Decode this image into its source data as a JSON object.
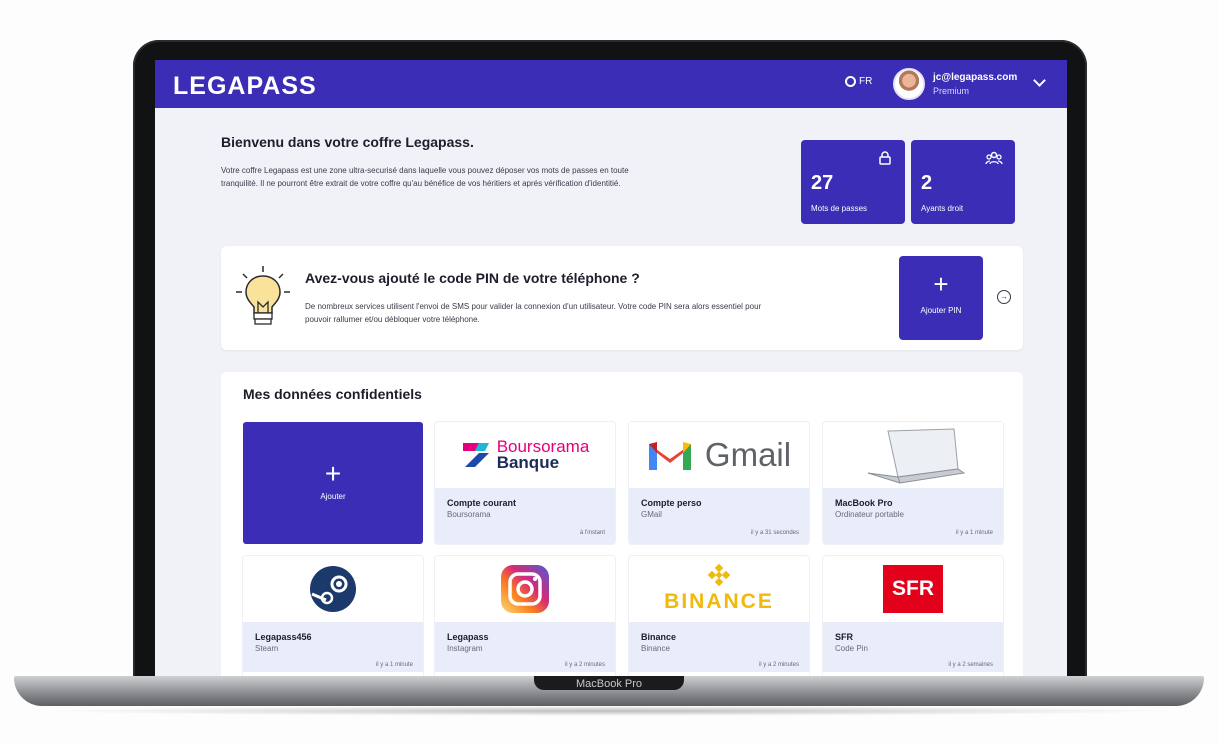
{
  "device": {
    "model_label": "MacBook Pro"
  },
  "header": {
    "logo": "LEGAPASS",
    "lang": "FR",
    "user_email": "jc@legapass.com",
    "user_plan": "Premium",
    "accent": "#3b2db5"
  },
  "welcome": {
    "title": "Bienvenu dans votre coffre Legapass.",
    "text": "Votre coffre Legapass est une zone ultra-securisé dans laquelle vous pouvez déposer vos mots de passes en toute tranquilité. Il ne pourront être extrait de votre coffre qu'au bénéfice de vos héritiers et aprés vérification d'identitié."
  },
  "stats": [
    {
      "value": "27",
      "label": "Mots de passes",
      "icon": "lock-icon"
    },
    {
      "value": "2",
      "label": "Ayants droit",
      "icon": "users-icon"
    }
  ],
  "pin_card": {
    "title": "Avez-vous ajouté le code PIN de votre téléphone ?",
    "text": "De nombreux services utilisent l'envoi de SMS pour valider la connexion d'un utilisateur. Votre code PIN sera alors essentiel pour pouvoir rallumer et/ou débloquer votre téléphone.",
    "button_label": "Ajouter PIN"
  },
  "data_section": {
    "title": "Mes données confidentiels",
    "add_label": "Ajouter",
    "items": [
      {
        "title": "Compte courant",
        "subtitle": "Boursorama",
        "time": "à l'instant",
        "logo_line1": "Boursorama",
        "logo_line2": "Banque"
      },
      {
        "title": "Compte perso",
        "subtitle": "GMail",
        "time": "il y a 31 secondes",
        "logo_text": "Gmail"
      },
      {
        "title": "MacBook Pro",
        "subtitle": "Ordinateur portable",
        "time": "il y a 1 minute"
      },
      {
        "title": "Legapass456",
        "subtitle": "Steam",
        "time": "il y a 1 minute"
      },
      {
        "title": "Legapass",
        "subtitle": "Instagram",
        "time": "il y a 2 minutes"
      },
      {
        "title": "Binance",
        "subtitle": "Binance",
        "time": "il y a 2 minutes",
        "logo_text": "BINANCE"
      },
      {
        "title": "SFR",
        "subtitle": "Code Pin",
        "time": "il y a 2 semaines",
        "logo_text": "SFR"
      }
    ]
  }
}
